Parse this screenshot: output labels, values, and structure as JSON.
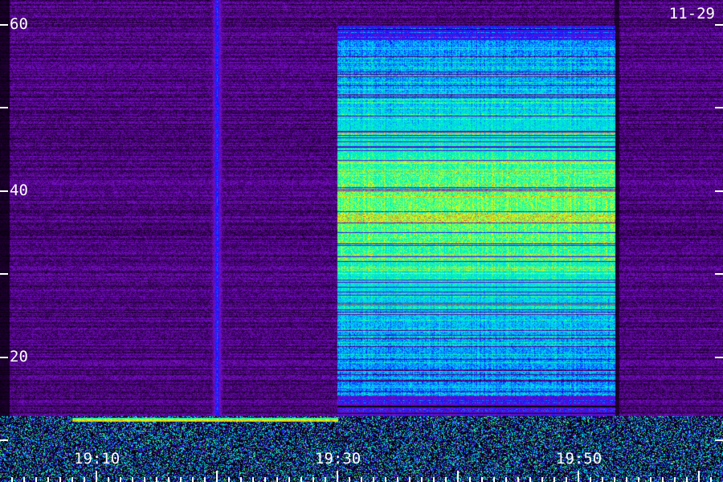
{
  "chart_data": {
    "type": "heatmap",
    "title": "",
    "date_label": "11-29",
    "xlabel": "",
    "ylabel": "",
    "y_ticks": [
      {
        "value": 60,
        "label": "60"
      },
      {
        "value": 50,
        "label": ""
      },
      {
        "value": 40,
        "label": "40"
      },
      {
        "value": 30,
        "label": ""
      },
      {
        "value": 20,
        "label": "20"
      },
      {
        "value": 10,
        "label": ""
      }
    ],
    "ylim": [
      5,
      63
    ],
    "x_ticks": [
      {
        "value": "19:10",
        "label": "19:10"
      },
      {
        "value": "19:30",
        "label": "19:30"
      },
      {
        "value": "19:50",
        "label": "19:50"
      }
    ],
    "xlim": [
      "19:02",
      "20:02"
    ],
    "colormap": [
      "#000000",
      "#3a0060",
      "#7a10c8",
      "#1010ff",
      "#00c8ff",
      "#00ffb0",
      "#ffff00",
      "#ff3000"
    ],
    "features": [
      {
        "kind": "vertical_band",
        "time": "19:20",
        "intensity": 0.45
      },
      {
        "kind": "strong_block",
        "time_range": [
          "19:30",
          "19:53"
        ],
        "freq_range": [
          13,
          60
        ],
        "peak_freq": 38,
        "peak_intensity": 0.82
      },
      {
        "kind": "horizontal_line",
        "time_range": [
          "19:08",
          "19:30"
        ],
        "freq": 12.5,
        "intensity": 0.95
      }
    ]
  }
}
